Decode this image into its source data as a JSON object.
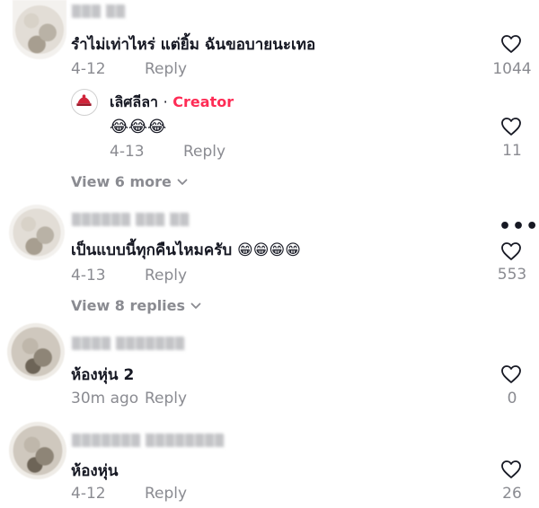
{
  "comments": [
    {
      "text": "รำไม่เท่าไหร่ แต่ยิ้ม ฉันขอบายนะเทอ",
      "date": "4-12",
      "reply_label": "Reply",
      "likes": "1044",
      "reply": {
        "creator": "เลิศลีลา",
        "separator": "·",
        "badge": "Creator",
        "emoji": "😂😂😂",
        "date": "4-13",
        "reply_label": "Reply",
        "likes": "11"
      },
      "view_more": "View 6 more"
    },
    {
      "text": "เป็นแบบนี้ทุกคืนไหมครับ 😁😁😁😁",
      "date": "4-13",
      "reply_label": "Reply",
      "likes": "553",
      "more_menu": "•••",
      "view_more": "View 8 replies"
    },
    {
      "text": "ห้องหุ่น 2",
      "date": "30m ago",
      "reply_label": "Reply",
      "likes": "0"
    },
    {
      "text": "ห้องหุ่น",
      "date": "4-12",
      "reply_label": "Reply",
      "likes": "26"
    }
  ],
  "icons": {
    "heart": "heart-outline-icon",
    "chevron": "chevron-down-icon",
    "more": "more-horizontal-icon"
  },
  "colors": {
    "text": "#161823",
    "muted": "#8a8b91",
    "creator_badge": "#fe2c55"
  }
}
